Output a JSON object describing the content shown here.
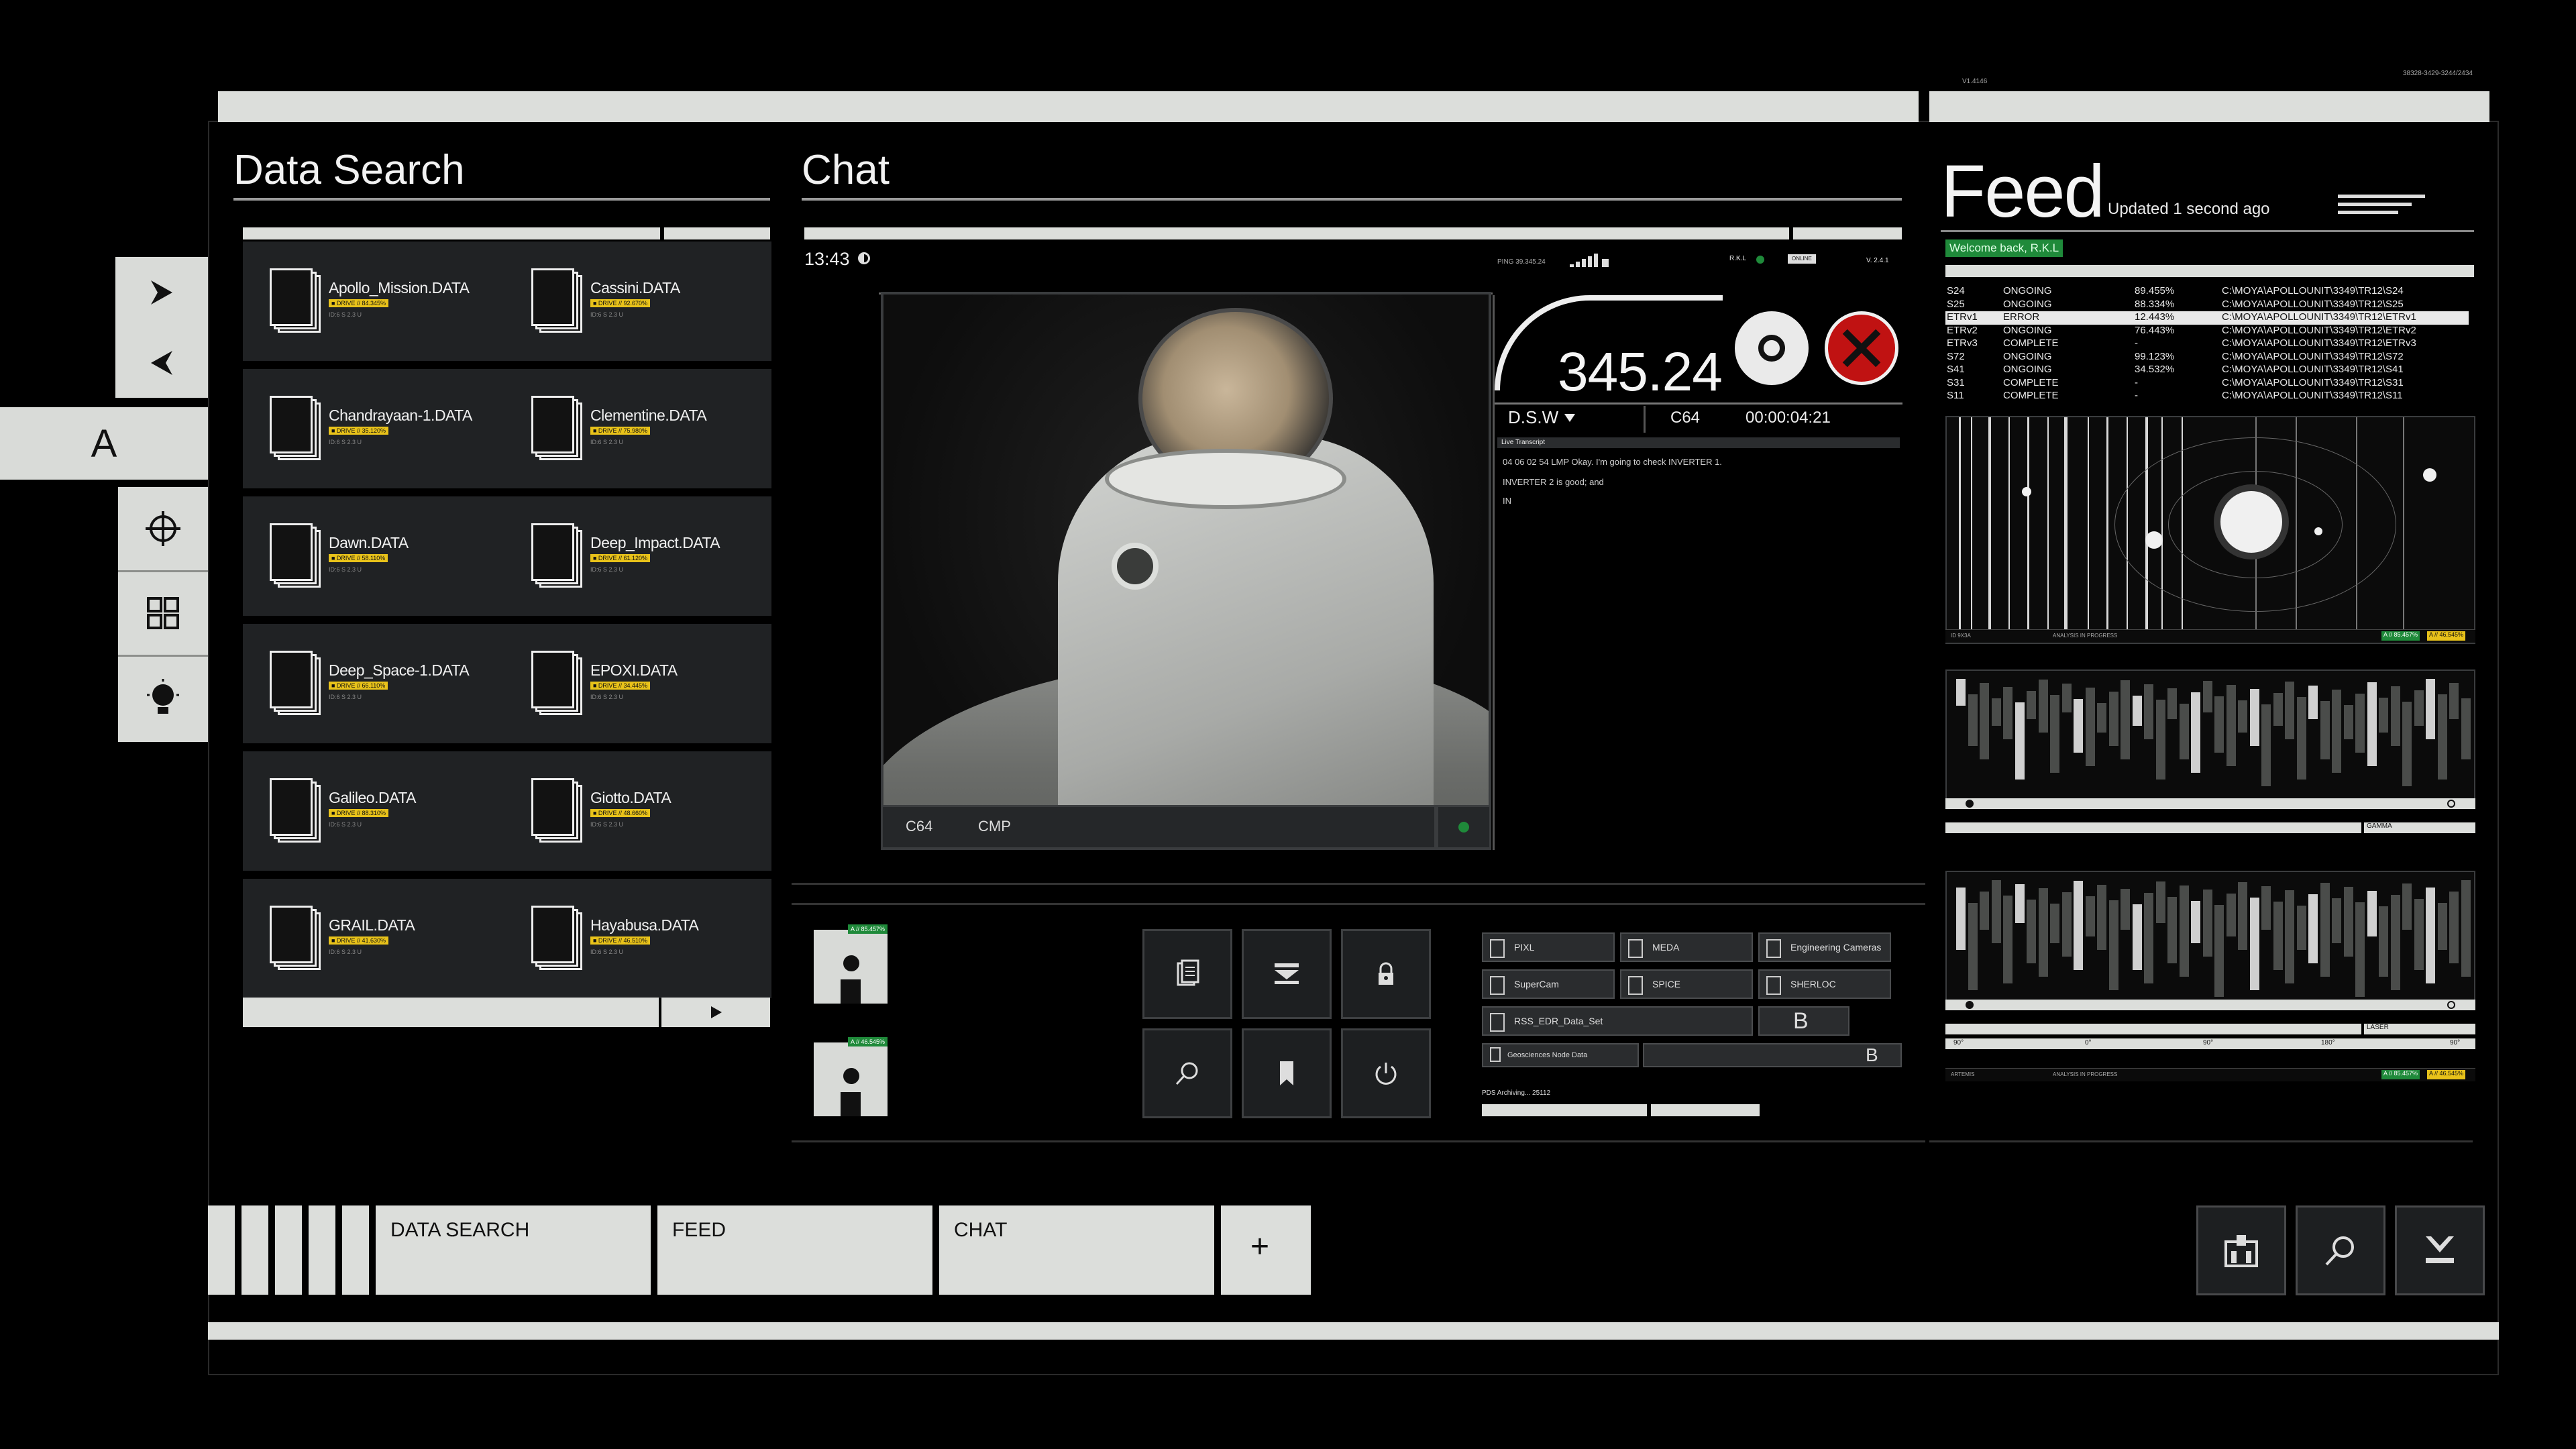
{
  "header": {
    "version": "V1.4146",
    "code": "38328-3429-3244/2434"
  },
  "dock": {
    "letter": "A",
    "icons": [
      "chevron-right-icon",
      "chevron-left-icon",
      "crosshair-icon",
      "grid-icon",
      "bulb-icon"
    ]
  },
  "data_search": {
    "title": "Data Search",
    "files": [
      {
        "name": "Apollo_Mission.DATA",
        "badge": "■ DRIVE // 84.345%"
      },
      {
        "name": "Cassini.DATA",
        "badge": "■ DRIVE // 92.670%"
      },
      {
        "name": "Chandrayaan-1.DATA",
        "badge": "■ DRIVE // 35.120%"
      },
      {
        "name": "Clementine.DATA",
        "badge": "■ DRIVE // 75.980%"
      },
      {
        "name": "Dawn.DATA",
        "badge": "■ DRIVE // 58.110%"
      },
      {
        "name": "Deep_Impact.DATA",
        "badge": "■ DRIVE // 61.120%"
      },
      {
        "name": "Deep_Space-1.DATA",
        "badge": "■ DRIVE // 66.110%"
      },
      {
        "name": "EPOXI.DATA",
        "badge": "■ DRIVE // 34.445%"
      },
      {
        "name": "Galileo.DATA",
        "badge": "■ DRIVE // 88.310%"
      },
      {
        "name": "Giotto.DATA",
        "badge": "■ DRIVE // 48.660%"
      },
      {
        "name": "GRAIL.DATA",
        "badge": "■ DRIVE // 41.630%"
      },
      {
        "name": "Hayabusa.DATA",
        "badge": "■ DRIVE // 46.510%"
      }
    ],
    "file_meta": "ID:6 S\n2.3 U"
  },
  "chat": {
    "title": "Chat",
    "time": "13:43",
    "ping": "PING 39.345.24",
    "rkl": "R.K.L",
    "online": "ONLINE",
    "version": "V. 2.4.1",
    "readout": "345.24",
    "dsw": "D.S.W",
    "channel": "C64",
    "timer": "00:00:04:21",
    "transcript_label": "Live Transcript",
    "transcript": [
      "04 06 02 54 LMP Okay. I'm going to check INVERTER 1.",
      "INVERTER 2 is good; and",
      "IN"
    ],
    "video_bar": {
      "channel": "C64",
      "role": "CMP"
    }
  },
  "tools": {
    "floppies": [
      {
        "tag": "A // 85.457%"
      },
      {
        "tag": "A // 46.545%"
      }
    ],
    "buttons": [
      "clipboard-icon",
      "inbox-icon",
      "lock-icon",
      "search-icon",
      "bookmark-icon",
      "power-icon"
    ],
    "datasets": {
      "row1": [
        "PIXL",
        "MEDA",
        "Engineering Cameras"
      ],
      "row2": [
        "SuperCam",
        "SPICE",
        "SHERLOC"
      ],
      "row3": "RSS_EDR_Data_Set",
      "row3_letter": "B",
      "row4": "Geosciences Node Data",
      "row4_letter": "B"
    },
    "archiving": "PDS Archiving... 25112"
  },
  "feed": {
    "title": "Feed",
    "updated": "Updated 1 second ago",
    "welcome": "Welcome back, R.K.L",
    "rows": [
      {
        "id": "S24",
        "status": "ONGOING",
        "pct": "89.455%",
        "path": "C:\\MOYA\\APOLLOUNIT\\3349\\TR12\\S24",
        "hl": false
      },
      {
        "id": "S25",
        "status": "ONGOING",
        "pct": "88.334%",
        "path": "C:\\MOYA\\APOLLOUNIT\\3349\\TR12\\S25",
        "hl": false
      },
      {
        "id": "ETRv1",
        "status": "ERROR",
        "pct": "12.443%",
        "path": "C:\\MOYA\\APOLLOUNIT\\3349\\TR12\\ETRv1",
        "hl": true
      },
      {
        "id": "ETRv2",
        "status": "ONGOING",
        "pct": "76.443%",
        "path": "C:\\MOYA\\APOLLOUNIT\\3349\\TR12\\ETRv2",
        "hl": false
      },
      {
        "id": "ETRv3",
        "status": "COMPLETE",
        "pct": "-",
        "path": "C:\\MOYA\\APOLLOUNIT\\3349\\TR12\\ETRv3",
        "hl": false
      },
      {
        "id": "S72",
        "status": "ONGOING",
        "pct": "99.123%",
        "path": "C:\\MOYA\\APOLLOUNIT\\3349\\TR12\\S72",
        "hl": false
      },
      {
        "id": "S41",
        "status": "ONGOING",
        "pct": "34.532%",
        "path": "C:\\MOYA\\APOLLOUNIT\\3349\\TR12\\S41",
        "hl": false
      },
      {
        "id": "S31",
        "status": "COMPLETE",
        "pct": "-",
        "path": "C:\\MOYA\\APOLLOUNIT\\3349\\TR12\\S31",
        "hl": false
      },
      {
        "id": "S11",
        "status": "COMPLETE",
        "pct": "-",
        "path": "C:\\MOYA\\APOLLOUNIT\\3349\\TR12\\S11",
        "hl": false
      }
    ],
    "viz1_footer_left": "ID 9X3A",
    "viz1_footer_mid": "ANALYSIS IN PROGRESS",
    "viz1_tag_a": "A // 85.457%",
    "viz1_tag_b": "A // 46.545%",
    "gamma": "GAMMA",
    "laser": "LASER",
    "deg": [
      "90°",
      "0°",
      "90°",
      "180°",
      "90°"
    ],
    "viz3_footer_left": "ARTEMIS",
    "viz3_footer_mid": "ANALYSIS IN PROGRESS"
  },
  "taskbar": {
    "tabs": [
      "DATA SEARCH",
      "FEED",
      "CHAT"
    ],
    "add": "+",
    "right_icons": [
      "network-icon",
      "search-icon",
      "download-icon"
    ]
  },
  "colors": {
    "panel_light": "#dcdedb",
    "error_red": "#c01212",
    "badge_yellow": "#e8c21a",
    "status_green": "#1f8a3a"
  }
}
